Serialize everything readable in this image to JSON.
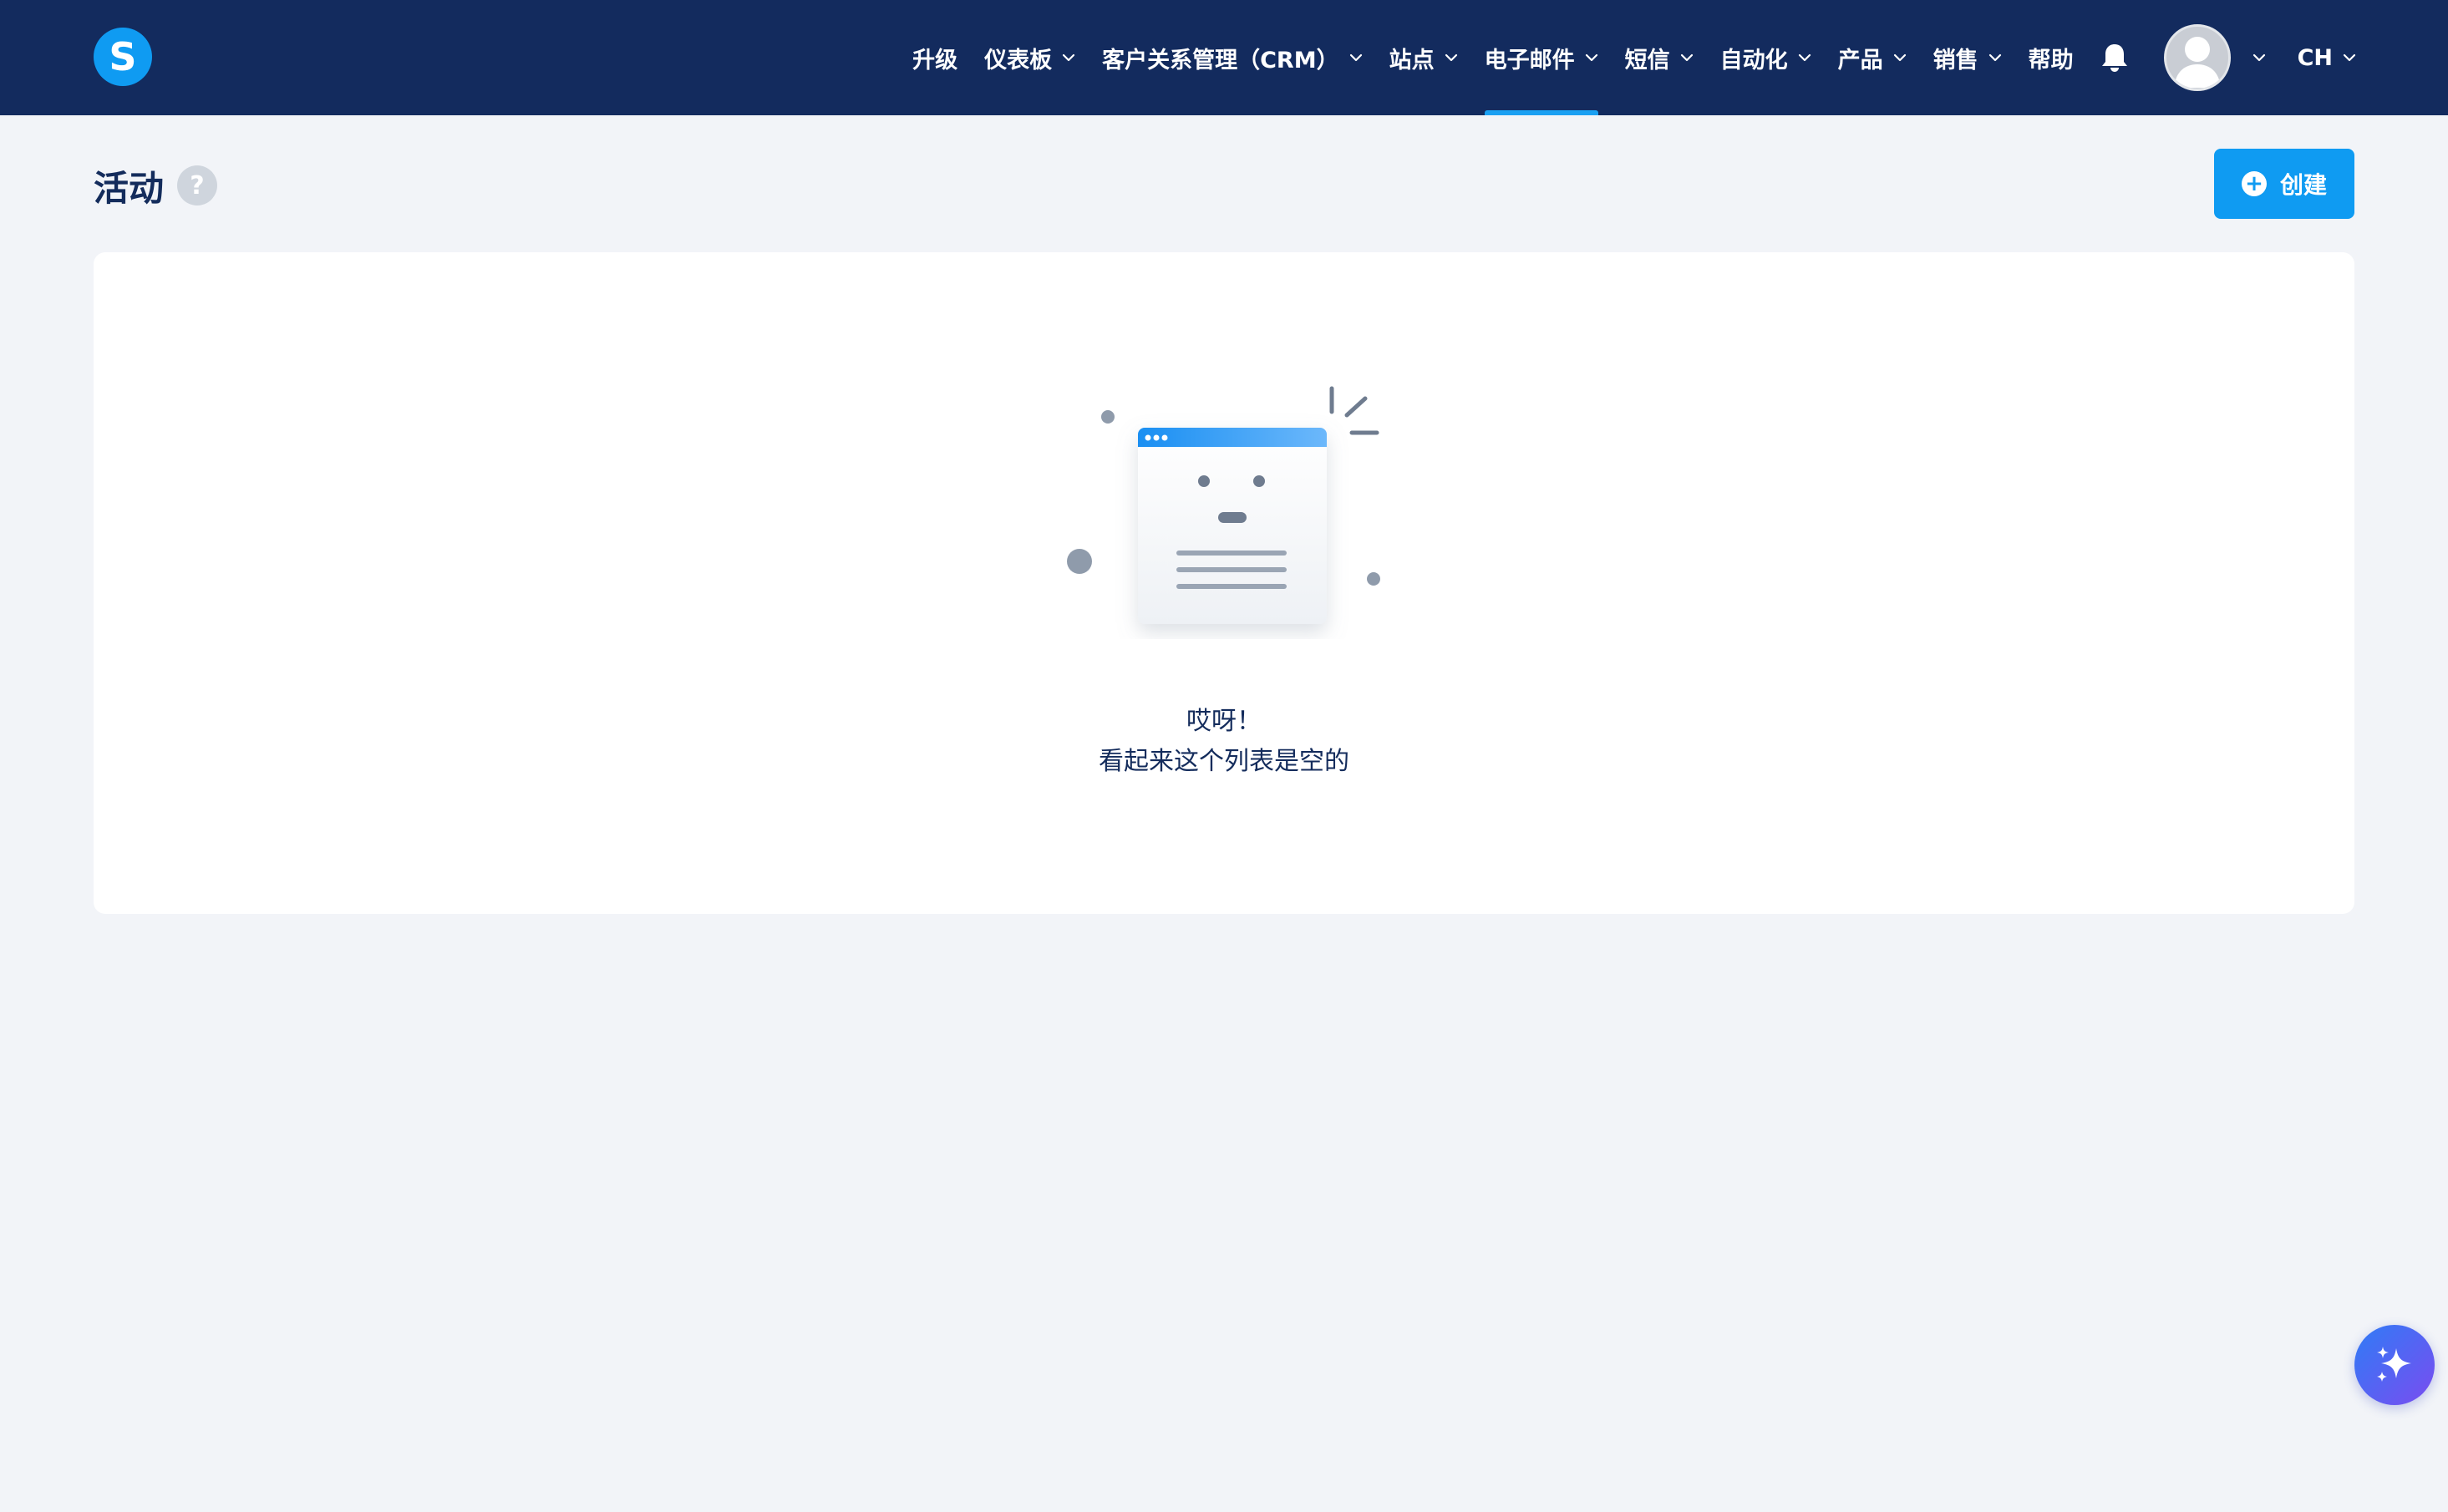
{
  "brand": {
    "logo_letter": "S",
    "color": "#0f9bf2"
  },
  "nav": {
    "items": [
      {
        "label": "升级",
        "has_dropdown": false,
        "active": false
      },
      {
        "label": "仪表板",
        "has_dropdown": true,
        "active": false
      },
      {
        "label": "客户关系管理（CRM）",
        "has_dropdown": true,
        "active": false
      },
      {
        "label": "站点",
        "has_dropdown": true,
        "active": false
      },
      {
        "label": "电子邮件",
        "has_dropdown": true,
        "active": true
      },
      {
        "label": "短信",
        "has_dropdown": true,
        "active": false
      },
      {
        "label": "自动化",
        "has_dropdown": true,
        "active": false
      },
      {
        "label": "产品",
        "has_dropdown": true,
        "active": false
      },
      {
        "label": "销售",
        "has_dropdown": true,
        "active": false
      },
      {
        "label": "帮助",
        "has_dropdown": false,
        "active": false
      }
    ],
    "notification_icon": "bell-icon",
    "language": "CH"
  },
  "page": {
    "title": "活动",
    "help_label": "?",
    "create_button": "创建"
  },
  "empty_state": {
    "title": "哎呀！",
    "subtitle": "看起来这个列表是空的"
  },
  "colors": {
    "topbar": "#132b5e",
    "accent": "#0f9bf2",
    "background": "#f2f4f8"
  }
}
